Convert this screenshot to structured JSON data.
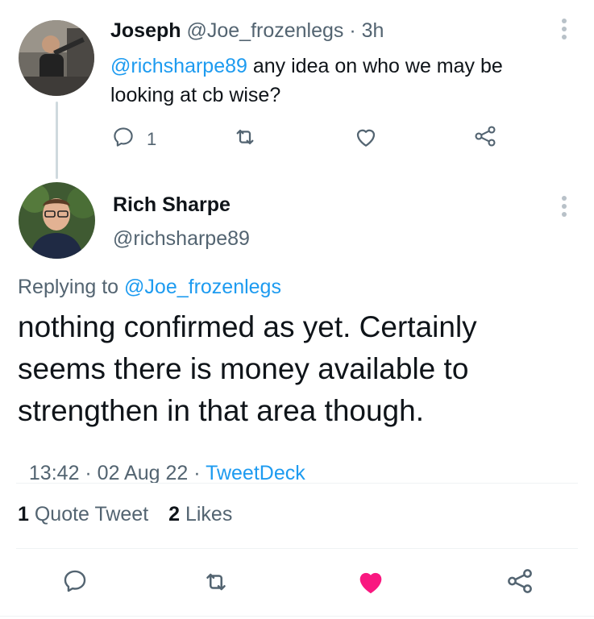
{
  "reply_tweet": {
    "display_name": "Joseph",
    "handle": "@Joe_frozenlegs",
    "time": "· 3h",
    "mention": "@richsharpe89",
    "text_line1": " any idea on who we may be",
    "text_line2": "looking at cb wise?",
    "reply_count": "1"
  },
  "main_tweet": {
    "display_name": "Rich Sharpe",
    "handle": "@richsharpe89",
    "replying_label": "Replying to",
    "replying_handle": "@Joe_frozenlegs",
    "text_line1": "nothing confirmed as yet. Certainly",
    "text_line2": "seems there is money available to",
    "text_line3": "strengthen in that area though.",
    "meta_time": "13:42 · 02 Aug 22 · ",
    "meta_source": "TweetDeck"
  },
  "stats": {
    "quote_count": "1",
    "quote_label": "Quote Tweet",
    "likes_count": "2",
    "likes_label": "Likes"
  },
  "colors": {
    "link": "#1d9bf0",
    "like_active": "#f91880",
    "muted": "#536471"
  },
  "icons": [
    "reply-icon",
    "retweet-icon",
    "like-icon",
    "share-icon",
    "more-icon"
  ]
}
